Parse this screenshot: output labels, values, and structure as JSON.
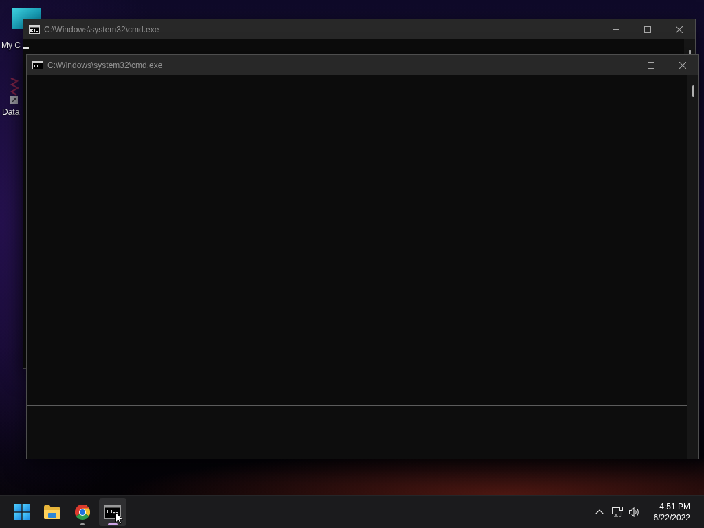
{
  "desktop": {
    "icons": [
      {
        "kind": "monitor",
        "label": "My C"
      },
      {
        "kind": "shortcut",
        "label": "Data"
      }
    ]
  },
  "windows": [
    {
      "title": "C:\\Windows\\system32\\cmd.exe",
      "cursor": true
    },
    {
      "title": "C:\\Windows\\system32\\cmd.exe",
      "cursor": false
    }
  ],
  "taskbar": {
    "apps": [
      {
        "kind": "start",
        "running": false,
        "selected": false
      },
      {
        "kind": "files",
        "running": false,
        "selected": false
      },
      {
        "kind": "browser",
        "running": true,
        "selected": false
      },
      {
        "kind": "terminal",
        "running": true,
        "selected": true
      }
    ],
    "clock": {
      "time": "4:51 PM",
      "date": "6/22/2022"
    }
  }
}
